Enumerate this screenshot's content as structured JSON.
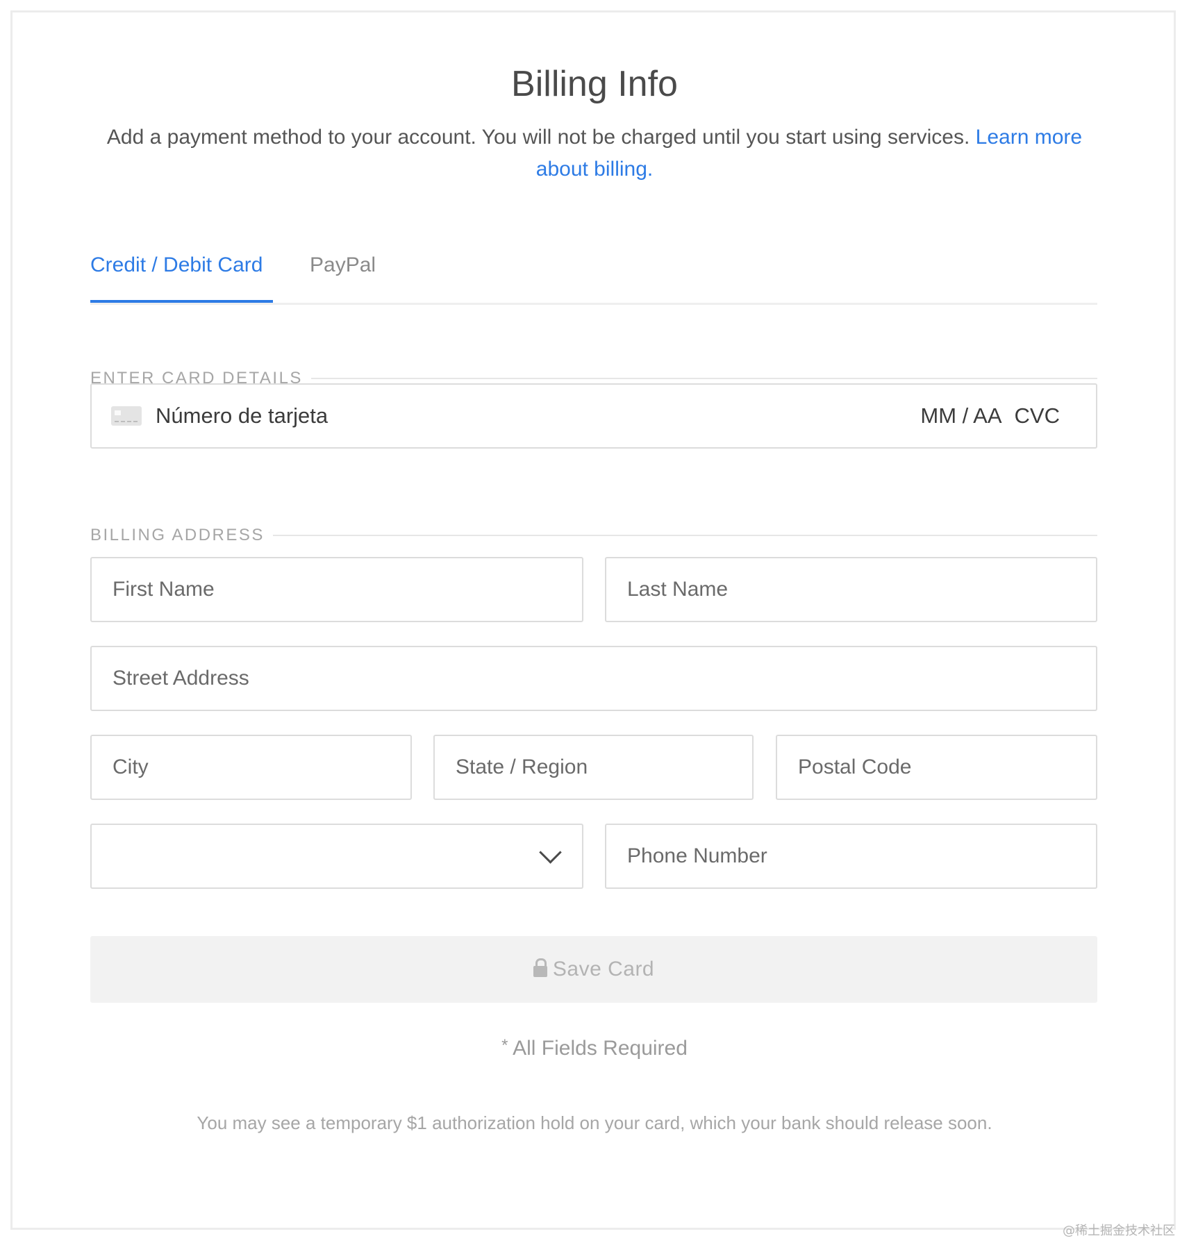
{
  "header": {
    "title": "Billing Info",
    "subtitle": "Add a payment method to your account. You will not be charged until you start using services.",
    "learn_more_link": "Learn more about billing."
  },
  "tabs": [
    {
      "label": "Credit / Debit Card",
      "active": true
    },
    {
      "label": "PayPal",
      "active": false
    }
  ],
  "card_section": {
    "label": "ENTER CARD DETAILS",
    "card_number_placeholder": "Número de tarjeta",
    "expiry_placeholder": "MM / AA",
    "cvc_placeholder": "CVC",
    "icon": "credit-card-icon"
  },
  "address_section": {
    "label": "BILLING ADDRESS",
    "first_name_placeholder": "First Name",
    "last_name_placeholder": "Last Name",
    "street_placeholder": "Street Address",
    "city_placeholder": "City",
    "state_placeholder": "State / Region",
    "postal_placeholder": "Postal Code",
    "country_selected": "",
    "phone_placeholder": "Phone Number"
  },
  "actions": {
    "save_label": "Save Card",
    "save_icon": "lock-icon",
    "save_disabled": true
  },
  "footer": {
    "required_star": "*",
    "required_text": "All Fields Required",
    "authorization_note": "You may see a temporary $1 authorization hold on your card, which your bank should release soon."
  },
  "watermark": "@稀土掘金技术社区",
  "colors": {
    "accent": "#2d7be5",
    "muted_text": "#a6a6a6",
    "border": "#dcdcdc",
    "disabled_button": "#f2f2f2"
  }
}
